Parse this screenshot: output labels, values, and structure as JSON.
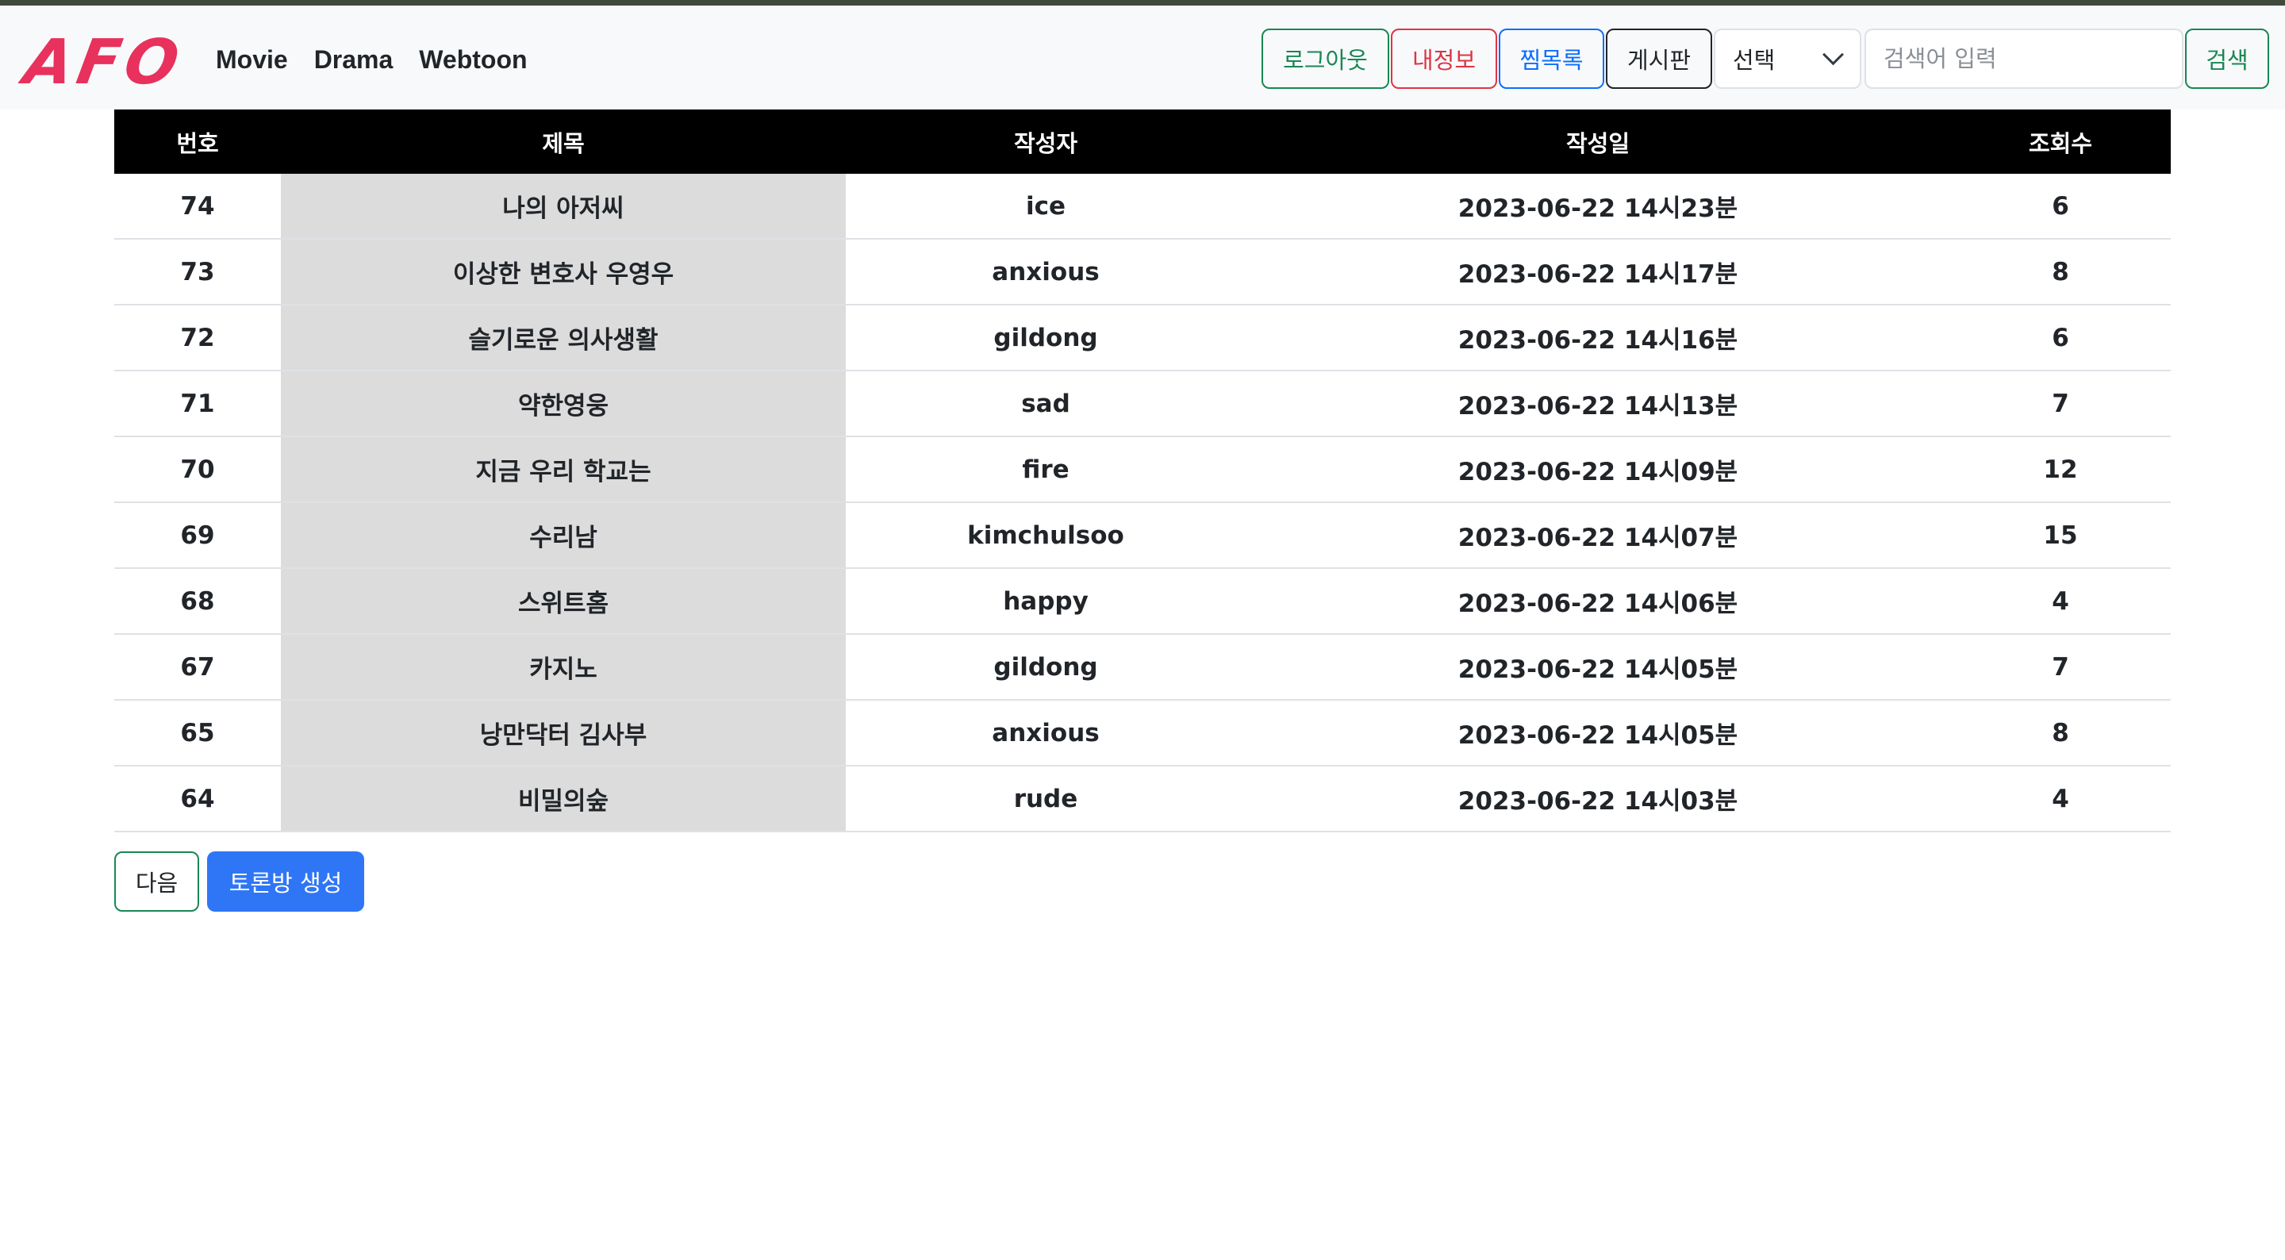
{
  "brand": {
    "logo_text": "AFO",
    "color": "#e8315c"
  },
  "nav": {
    "links": [
      {
        "label": "Movie"
      },
      {
        "label": "Drama"
      },
      {
        "label": "Webtoon"
      }
    ]
  },
  "toolbar": {
    "logout_label": "로그아웃",
    "myinfo_label": "내정보",
    "wishlist_label": "찜목록",
    "board_label": "게시판",
    "select_value": "선택",
    "search_placeholder": "검색어 입력",
    "search_value": "",
    "search_button_label": "검색"
  },
  "table": {
    "headers": {
      "number": "번호",
      "title": "제목",
      "author": "작성자",
      "date": "작성일",
      "views": "조회수"
    },
    "rows": [
      {
        "number": "74",
        "title": "나의 아저씨",
        "author": "ice",
        "date": "2023-06-22 14시23분",
        "views": "6"
      },
      {
        "number": "73",
        "title": "이상한 변호사 우영우",
        "author": "anxious",
        "date": "2023-06-22 14시17분",
        "views": "8"
      },
      {
        "number": "72",
        "title": "슬기로운 의사생활",
        "author": "gildong",
        "date": "2023-06-22 14시16분",
        "views": "6"
      },
      {
        "number": "71",
        "title": "약한영웅",
        "author": "sad",
        "date": "2023-06-22 14시13분",
        "views": "7"
      },
      {
        "number": "70",
        "title": "지금 우리 학교는",
        "author": "fire",
        "date": "2023-06-22 14시09분",
        "views": "12"
      },
      {
        "number": "69",
        "title": "수리남",
        "author": "kimchulsoo",
        "date": "2023-06-22 14시07분",
        "views": "15"
      },
      {
        "number": "68",
        "title": "스위트홈",
        "author": "happy",
        "date": "2023-06-22 14시06분",
        "views": "4"
      },
      {
        "number": "67",
        "title": "카지노",
        "author": "gildong",
        "date": "2023-06-22 14시05분",
        "views": "7"
      },
      {
        "number": "65",
        "title": "낭만닥터 김사부",
        "author": "anxious",
        "date": "2023-06-22 14시05분",
        "views": "8"
      },
      {
        "number": "64",
        "title": "비밀의숲",
        "author": "rude",
        "date": "2023-06-22 14시03분",
        "views": "4"
      }
    ]
  },
  "footer": {
    "next_label": "다음",
    "create_label": "토론방 생성"
  },
  "colors": {
    "success": "#198754",
    "danger": "#dc3545",
    "primary": "#0d6efd",
    "create_button": "#2f76f6",
    "header_bg": "#000000",
    "title_cell_bg": "#dcdcdc"
  }
}
